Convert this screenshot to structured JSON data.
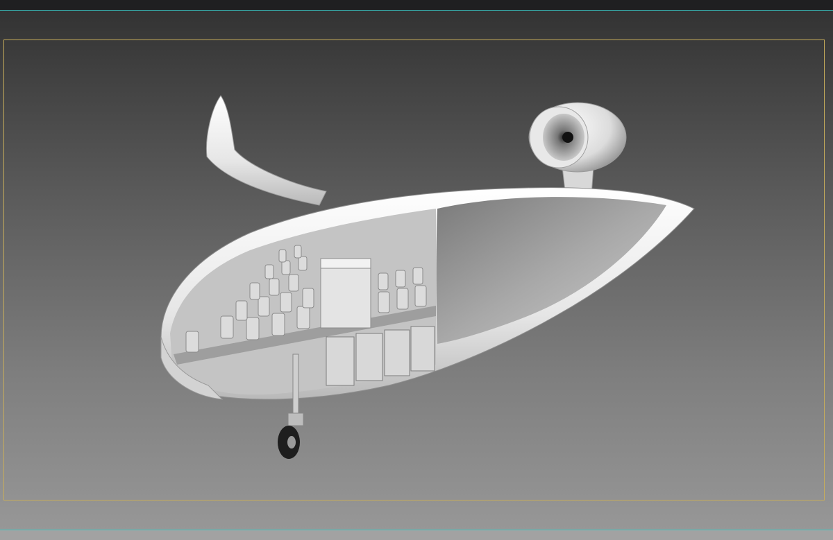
{
  "viewport": {
    "model_name": "aircraft-cutaway-model",
    "colors": {
      "top_bar": "#1f1f21",
      "accent_line": "#3fc9c6",
      "safe_frame": "#c7ad5b",
      "background_top": "#333333",
      "background_bottom": "#979797",
      "model_shell": "#f0f0f0",
      "model_interior": "#b8b8b8"
    }
  }
}
